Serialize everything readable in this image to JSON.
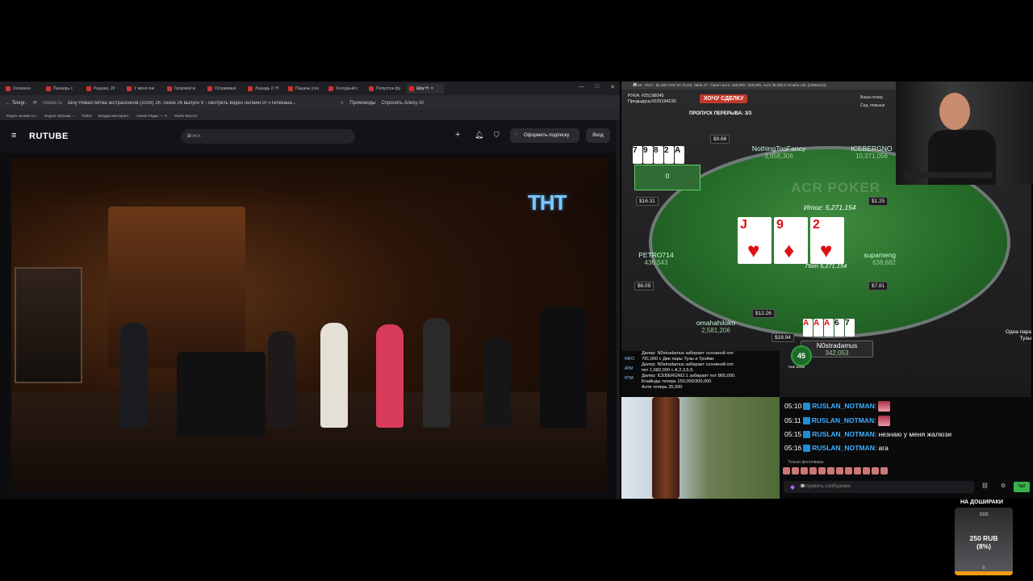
{
  "browser": {
    "tabs": [
      {
        "label": "Ouraaeus"
      },
      {
        "label": "Панцирь с"
      },
      {
        "label": "Рацнаю, 20"
      },
      {
        "label": "У меня очк"
      },
      {
        "label": "Грозовой м"
      },
      {
        "label": "Оторвавше"
      },
      {
        "label": "Лошадь 2: Н"
      },
      {
        "label": "Пацаны (сез"
      },
      {
        "label": "Холодный с"
      },
      {
        "label": "Полуспон фу"
      },
      {
        "label": "Шоу Н"
      }
    ],
    "address": {
      "back": "← Telegr..",
      "url": "rutube.ru",
      "page_title": "Шоу Новая битва экстрасенсов (2026) 26, сезон 26 выпуск 9 - смотреть видео онлайн от «Телекана...",
      "promo": "Промокоды",
      "alice": "Спросить Алису AI"
    },
    "bookmarks": [
      "Радио онлайн Сл..",
      "Яндекс Музыка —",
      "Twitch",
      "Владислав Кирил..",
      "Новое Радио — Р..",
      "Radio Record"
    ]
  },
  "rutube": {
    "logo": "RUTUBE",
    "search_placeholder": "Поиск",
    "subscribe": "Оформить подписку",
    "login": "Вход",
    "channel_logo": "ТНТ"
  },
  "poker": {
    "window_title": "$5.50 - PKO - $1,000 GTD 5C PLO8, Table 27 - Принт-анте: 150,000 / 300,000, Анте 35,000 5 Omaha Hi/L (24954213)",
    "hand_info": "РУКА: #25198045",
    "prev_hand": "Предыдущ:#225194230",
    "deal_button": "ХОЧУ СДЕЛКУ",
    "break_button": "ПРОПУСК ПЕРЕРЫВА: 3/3",
    "position_opt1": "Ваша позиц",
    "position_opt2": "Сед. повыше",
    "total": "Итог: 5,271,154",
    "pot": "Пот 5,271,154",
    "watermark": "ACR POKER",
    "board": [
      {
        "rank": "J",
        "suit": "♥"
      },
      {
        "rank": "9",
        "suit": "♦"
      },
      {
        "rank": "2",
        "suit": "♥"
      }
    ],
    "seats": [
      {
        "name": "NothingTooFancy",
        "stack": "3,958,306"
      },
      {
        "name": "ICEBERGNO",
        "stack": "10,371,056"
      },
      {
        "name": "PETRO714",
        "stack": "436,543"
      },
      {
        "name": "supameng",
        "stack": "638,682"
      },
      {
        "name": "omahahiloko",
        "stack": "2,581,206"
      },
      {
        "name": "N0stradamus",
        "stack": "342,053"
      },
      {
        "name": "",
        "stack": "0"
      }
    ],
    "hero_cards": [
      "A",
      "A",
      "A",
      "6",
      "7"
    ],
    "opponent_cards": [
      "7",
      "9",
      "8",
      "2",
      "A"
    ],
    "bounties": [
      "$9.68",
      "$16.31",
      "$1.25",
      "$6.09",
      "$7.81",
      "$12.26",
      "$18.94"
    ],
    "timebank_value": "45",
    "timebank_label": "TIME BANK",
    "hand_rank": "Одна пара Тузы",
    "log_tabs": [
      "INFO",
      "ATM",
      "HTM"
    ],
    "log": [
      "Дилер: N0stradamus забирает основной пот",
      "791,000 с Две пары Тузы и Тройки.",
      "Дилер: N0stradamus забирает основной пот",
      "пот 1,582,000 с A,2,3,5,6.",
      "Дилер: ICEBERGNO.1 забирает пот 865,000.",
      "Блайнды теперь 150,000/300,000",
      "Анте теперь 35,000"
    ]
  },
  "chat": {
    "messages": [
      {
        "time": "05:10",
        "user": "RUSLAN_NOTMAN",
        "text": ""
      },
      {
        "time": "05:11",
        "user": "RUSLAN_NOTMAN",
        "text": ""
      },
      {
        "time": "05:15",
        "user": "RUSLAN_NOTMAN",
        "text": "незнаю у меня жалюзи"
      },
      {
        "time": "05:16",
        "user": "RUSLAN_NOTMAN",
        "text": "ага"
      }
    ],
    "followers_only": "Только фолловеры",
    "input_placeholder": "Отправить сообщение",
    "send_button": "Чат"
  },
  "donation": {
    "title": "НА ДОШИРАКИ",
    "top": "3333",
    "amount": "250 RUB",
    "percent": "(8%)",
    "bottom": "0",
    "progress": 0.08
  }
}
